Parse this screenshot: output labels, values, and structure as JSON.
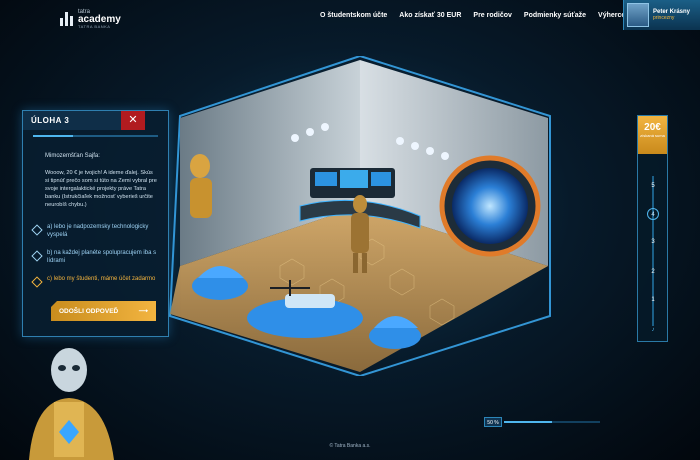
{
  "header": {
    "logo": {
      "line1": "tatra",
      "line2": "academy",
      "line3": "TATRA BANKA"
    },
    "nav": [
      "O študentskom účte",
      "Ako získať 30 EUR",
      "Pre rodičov",
      "Podmienky súťaže",
      "Výhercovia"
    ],
    "user": {
      "name": "Peter Krásny",
      "role": "princezny"
    }
  },
  "task": {
    "title": "ÚLOHA 3",
    "close_icon": "close-icon",
    "from": "Mimozemšťan Sajfa:",
    "message": "Wooow, 20 € je tvojich! A ideme ďalej. Skús si tipnúť prečo som si túto na Zemi vybral pre svoje intergalaktické projekty práve Tatra banku (Istrukčiaľek možnosť vyberieš určite neurobíš chybu.)",
    "options": [
      {
        "label": "a) lebo je nadpozemsky technologicky vyspelá",
        "selected": false
      },
      {
        "label": "b) na každej planéte spolupracujem iba s lídrami",
        "selected": false
      },
      {
        "label": "c) lebo my študenti, máme účet zadarmo",
        "selected": true
      }
    ],
    "submit": "ODOŠLI ODPOVEĎ",
    "submit_arrow": "⟶"
  },
  "rail": {
    "score": "20€",
    "score_label": "získaná suma",
    "steps": [
      "5",
      "4",
      "3",
      "2",
      "1"
    ],
    "active_step": "4",
    "icon": "music-note-icon"
  },
  "progress": {
    "label": "50 %",
    "value": 0.5
  },
  "footer": "© Tatra Banka a.s.",
  "colors": {
    "accent": "#4fb6ee",
    "gold": "#f2b440",
    "red": "#b11b1f"
  }
}
